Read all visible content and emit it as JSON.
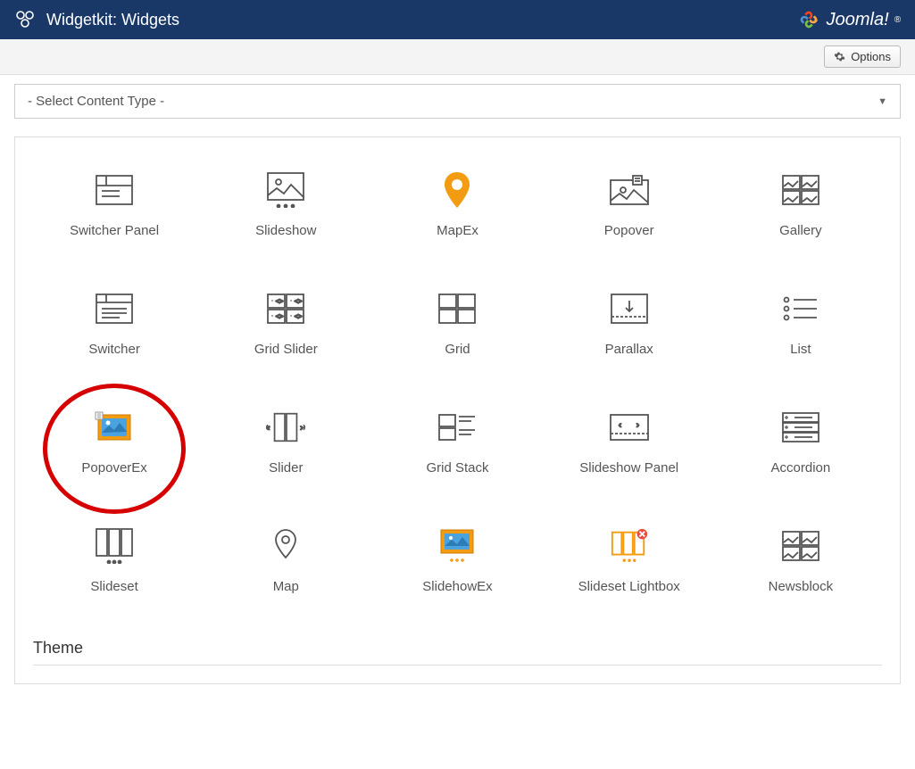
{
  "header": {
    "title": "Widgetkit: Widgets",
    "brand": "Joomla!"
  },
  "toolbar": {
    "options_label": "Options"
  },
  "select": {
    "label": "- Select Content Type -"
  },
  "widgets": [
    {
      "id": "switcher-panel",
      "label": "Switcher Panel"
    },
    {
      "id": "slideshow",
      "label": "Slideshow"
    },
    {
      "id": "mapex",
      "label": "MapEx"
    },
    {
      "id": "popover",
      "label": "Popover"
    },
    {
      "id": "gallery",
      "label": "Gallery"
    },
    {
      "id": "switcher",
      "label": "Switcher"
    },
    {
      "id": "grid-slider",
      "label": "Grid Slider"
    },
    {
      "id": "grid",
      "label": "Grid"
    },
    {
      "id": "parallax",
      "label": "Parallax"
    },
    {
      "id": "list",
      "label": "List"
    },
    {
      "id": "popoverex",
      "label": "PopoverEx",
      "highlighted": true
    },
    {
      "id": "slider",
      "label": "Slider"
    },
    {
      "id": "grid-stack",
      "label": "Grid Stack"
    },
    {
      "id": "slideshow-panel",
      "label": "Slideshow Panel"
    },
    {
      "id": "accordion",
      "label": "Accordion"
    },
    {
      "id": "slideset",
      "label": "Slideset"
    },
    {
      "id": "map",
      "label": "Map"
    },
    {
      "id": "slideshowex",
      "label": "SlidehowEx"
    },
    {
      "id": "slideset-lightbox",
      "label": "Slideset Lightbox"
    },
    {
      "id": "newsblock",
      "label": "Newsblock"
    }
  ],
  "theme": {
    "heading": "Theme"
  }
}
